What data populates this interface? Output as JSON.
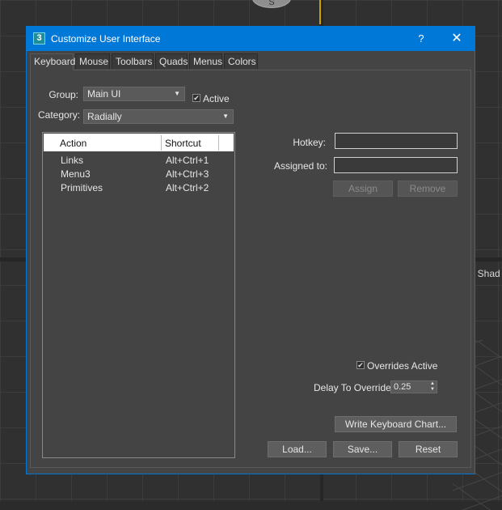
{
  "viewport": {
    "gizmo_label": "S",
    "side_label": "t Shad"
  },
  "dialog": {
    "app_icon": "3",
    "title": "Customize User Interface",
    "help_label": "?",
    "close_label": "✕"
  },
  "tabs": [
    {
      "label": "Keyboard",
      "active": true
    },
    {
      "label": "Mouse"
    },
    {
      "label": "Toolbars"
    },
    {
      "label": "Quads"
    },
    {
      "label": "Menus"
    },
    {
      "label": "Colors"
    }
  ],
  "form": {
    "group_label": "Group:",
    "group_value": "Main UI",
    "active_label": "Active",
    "active_checked": true,
    "category_label": "Category:",
    "category_value": "Radially"
  },
  "list": {
    "col_action": "Action",
    "col_shortcut": "Shortcut",
    "rows": [
      {
        "action": "Links",
        "shortcut": "Alt+Ctrl+1"
      },
      {
        "action": "Menu3",
        "shortcut": "Alt+Ctrl+3"
      },
      {
        "action": "Primitives",
        "shortcut": "Alt+Ctrl+2"
      }
    ]
  },
  "right": {
    "hotkey_label": "Hotkey:",
    "hotkey_value": "",
    "assigned_label": "Assigned to:",
    "assigned_value": "",
    "assign_btn": "Assign",
    "remove_btn": "Remove",
    "overrides_label": "Overrides Active",
    "overrides_checked": true,
    "delay_label": "Delay To Override:",
    "delay_value": "0.25",
    "write_chart_btn": "Write Keyboard Chart...",
    "load_btn": "Load...",
    "save_btn": "Save...",
    "reset_btn": "Reset"
  },
  "colors": {
    "accent": "#0078d7",
    "dialog_bg": "#444444",
    "viewport_bg": "#303030"
  }
}
